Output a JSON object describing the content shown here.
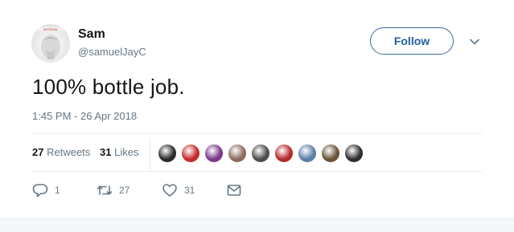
{
  "user": {
    "name": "Sam",
    "handle": "@samuelJayC",
    "avatar_caption": "ARSENAL"
  },
  "follow_label": "Follow",
  "tweet": {
    "text": "100% bottle job.",
    "timestamp": "1:45 PM - 26 Apr 2018"
  },
  "stats": {
    "retweets_count": "27",
    "retweets_label": "Retweets",
    "likes_count": "31",
    "likes_label": "Likes"
  },
  "likers": [
    {
      "name": "liker-1",
      "color": "#2b2a2a"
    },
    {
      "name": "liker-2",
      "color": "#c62a2a"
    },
    {
      "name": "liker-3",
      "color": "#7a3a8c"
    },
    {
      "name": "liker-4",
      "color": "#8a6b5e"
    },
    {
      "name": "liker-5",
      "color": "#4d4d4d"
    },
    {
      "name": "liker-6",
      "color": "#b52b2b"
    },
    {
      "name": "liker-7",
      "color": "#5d7fa8"
    },
    {
      "name": "liker-8",
      "color": "#6b5338"
    },
    {
      "name": "liker-9",
      "color": "#2f2f2f"
    }
  ],
  "actions": {
    "reply_count": "1",
    "retweet_count": "27",
    "like_count": "31"
  },
  "icons": {
    "reply": "reply-icon",
    "retweet": "retweet-icon",
    "like": "heart-icon",
    "dm": "envelope-icon",
    "more": "chevron-down-icon"
  },
  "colors": {
    "accent": "#1da1f2",
    "secondary_text": "#657786",
    "primary_text": "#14171a"
  }
}
